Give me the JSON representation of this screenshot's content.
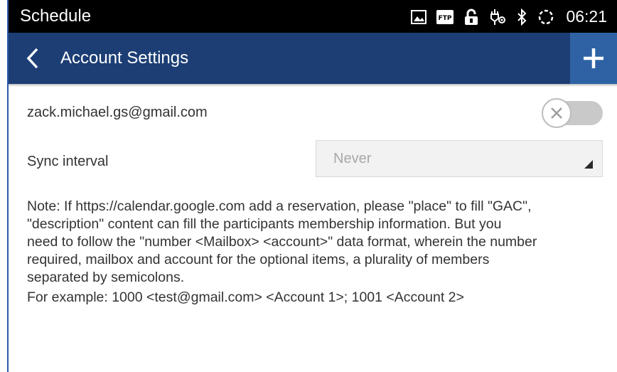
{
  "status_bar": {
    "app_title": "Schedule",
    "time": "06:21",
    "icons": [
      "image-icon",
      "ftp-icon",
      "lock-icon",
      "usb-icon",
      "bluetooth-icon",
      "sync-icon"
    ],
    "ftp_label": "FTP"
  },
  "action_bar": {
    "title": "Account Settings",
    "back_icon": "chevron-left-icon",
    "add_icon": "plus-icon",
    "color": "#1c3e74",
    "add_color": "#2e62a4"
  },
  "account": {
    "email": "zack.michael.gs@gmail.com",
    "enabled": false
  },
  "sync": {
    "label": "Sync interval",
    "value": "Never"
  },
  "note": {
    "lines": [
      "Note: If https://calendar.google.com add a reservation, please \"place\" to fill \"GAC\",",
      "\"description\" content can fill the participants membership information. But you",
      "need to follow the \"number <Mailbox> <account>\" data format, wherein the number",
      "required, mailbox and account for the optional items, a plurality of members",
      "separated by semicolons."
    ],
    "example": "For example: 1000 <test@gmail.com> <Account 1>; 1001 <Account 2>"
  }
}
